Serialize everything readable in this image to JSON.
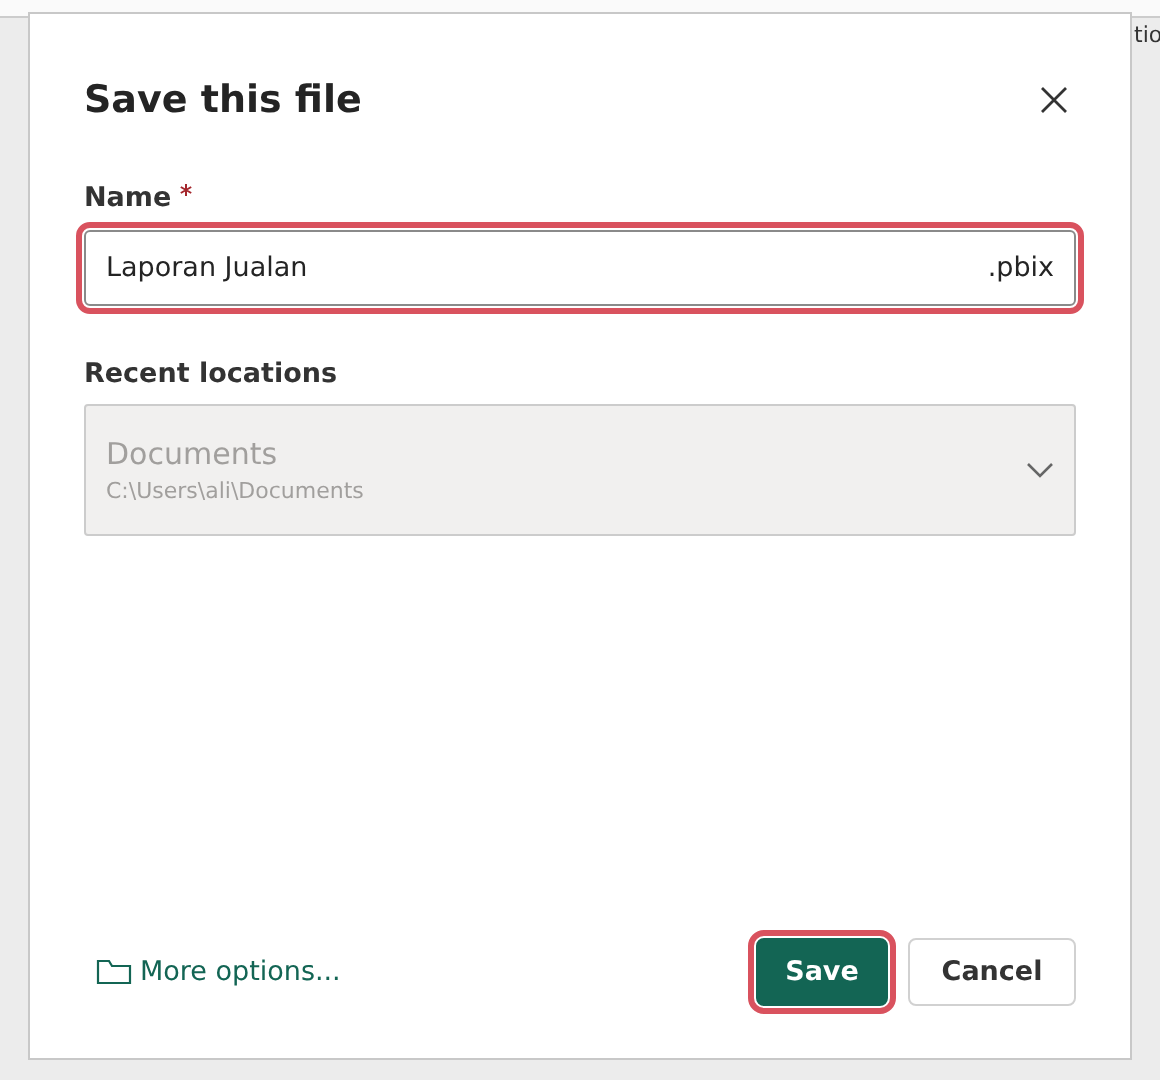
{
  "background": {
    "side_label": "tio"
  },
  "dialog": {
    "title": "Save this file",
    "name_field": {
      "label": "Name",
      "required": true,
      "value": "Laporan Jualan",
      "suffix": ".pbix",
      "highlighted": true
    },
    "recent_locations": {
      "label": "Recent locations",
      "disabled": true,
      "title": "Documents",
      "path": "C:\\Users\\ali\\Documents"
    },
    "more_options": "More options...",
    "buttons": [
      {
        "label": "Save",
        "kind": "primary",
        "highlighted": true
      },
      {
        "label": "Cancel",
        "kind": "secondary",
        "highlighted": false
      }
    ]
  }
}
